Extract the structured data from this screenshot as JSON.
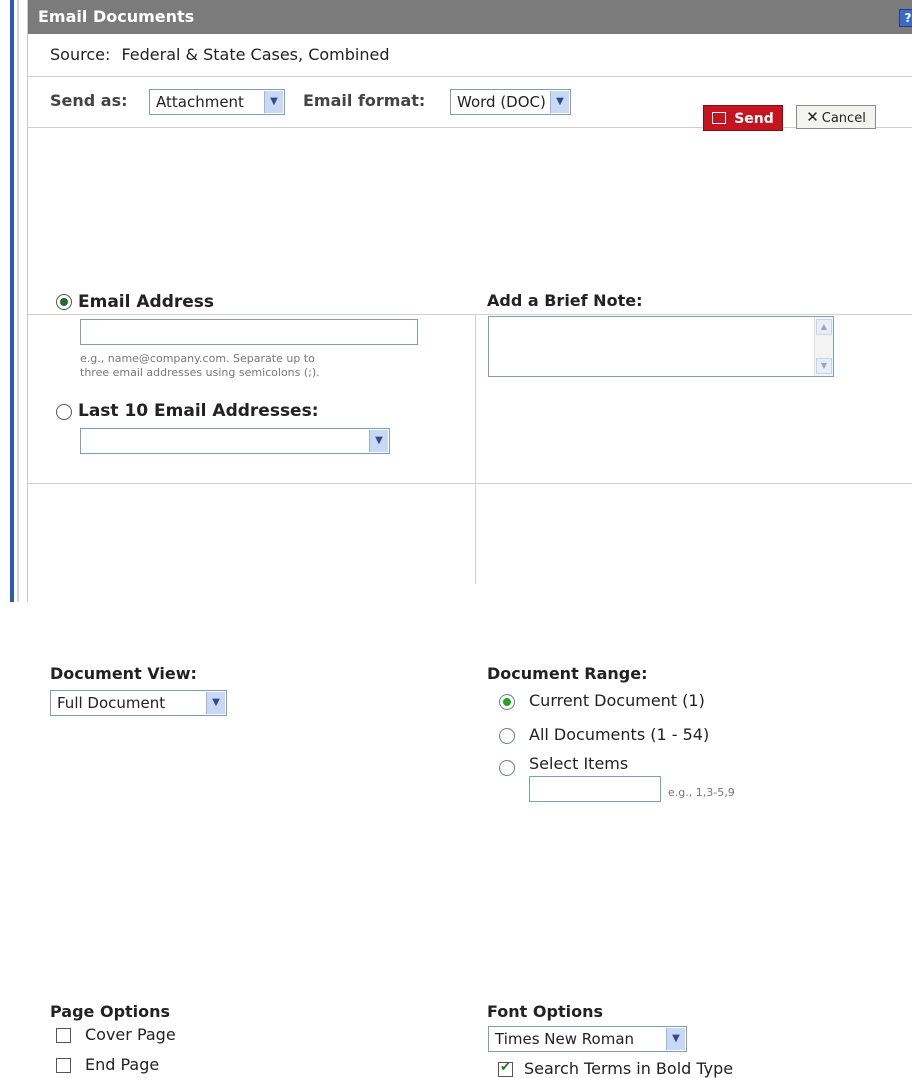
{
  "dialog": {
    "title": "Email Documents",
    "help_label": "?"
  },
  "source": {
    "label": "Source:",
    "value": "Federal & State Cases, Combined"
  },
  "send_row": {
    "send_as_label": "Send as:",
    "send_as_value": "Attachment",
    "email_format_label": "Email format:",
    "email_format_value": "Word (DOC)",
    "send_label": "Send",
    "cancel_label": "Cancel"
  },
  "recipients": {
    "email_address_label": "Email Address",
    "email_address_value": "",
    "email_hint_line1": "e.g., name@company.com. Separate up to",
    "email_hint_line2": "three email addresses using semicolons (;).",
    "last10_label": "Last 10 Email Addresses:",
    "last10_value": "",
    "note_label": "Add a Brief Note:",
    "note_value": ""
  },
  "document_view": {
    "label": "Document View:",
    "value": "Full Document"
  },
  "document_range": {
    "label": "Document Range:",
    "current": "Current Document (1)",
    "all": "All Documents (1 - 54)",
    "select_items": "Select Items",
    "select_hint": "e.g., 1,3-5,9",
    "select_value": ""
  },
  "page_options": {
    "label": "Page Options",
    "cover_page": "Cover Page",
    "end_page": "End Page"
  },
  "font_options": {
    "label": "Font Options",
    "font_value": "Times New Roman",
    "bold_terms": "Search Terms in Bold Type"
  },
  "colors": {
    "titlebar": "#7b7b7b",
    "send_button": "#c4141f",
    "accent_blue": "#2e5bb0"
  }
}
